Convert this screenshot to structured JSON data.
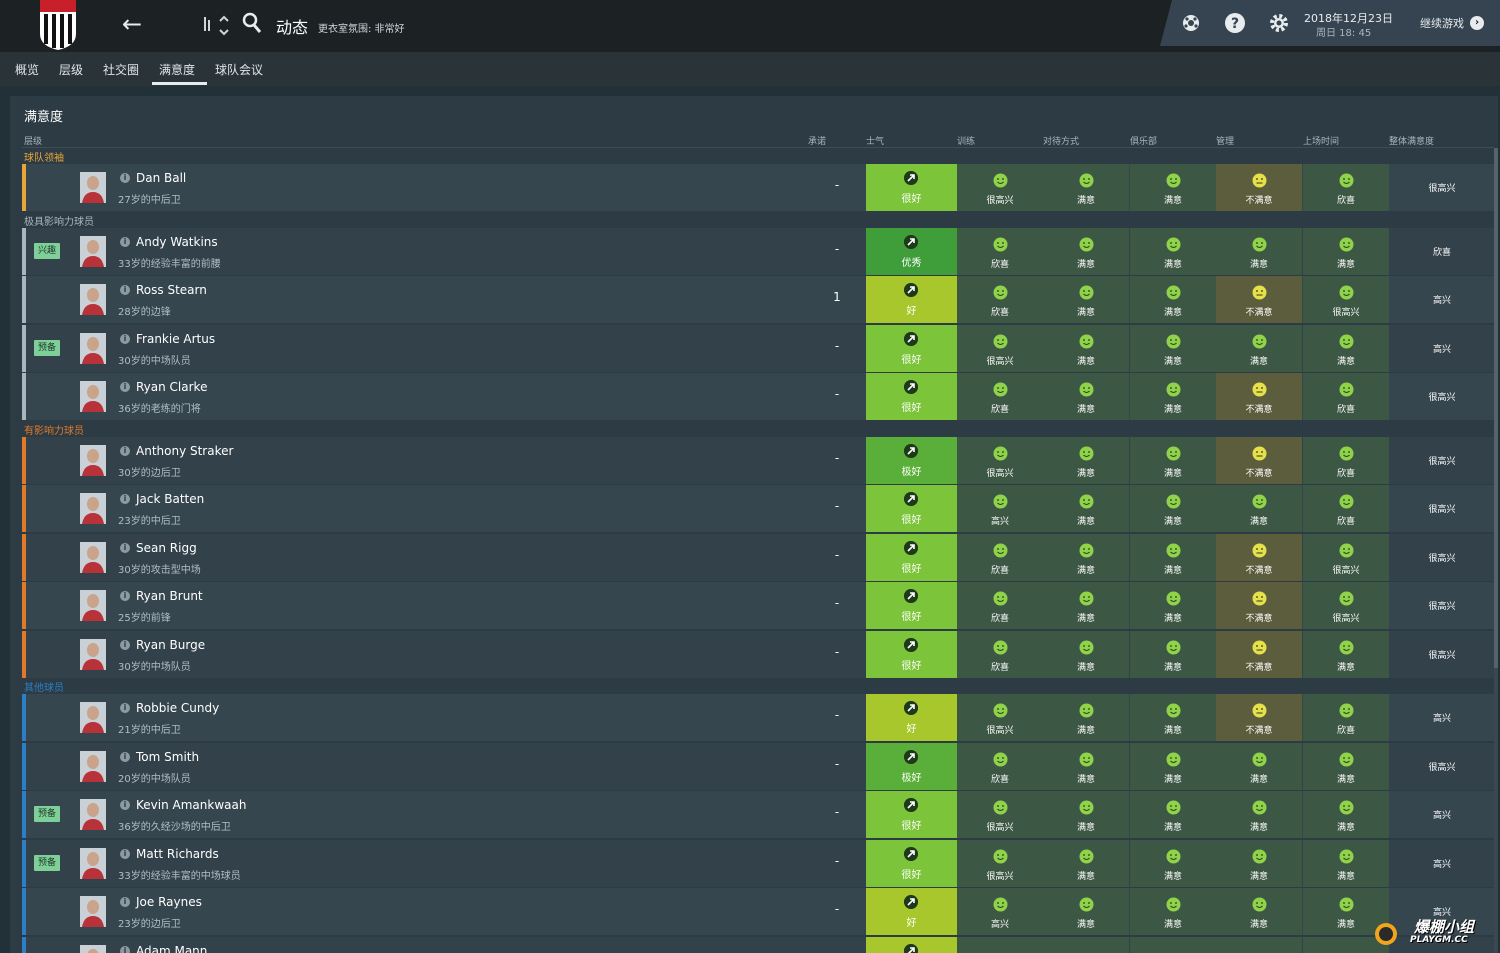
{
  "header": {
    "title": "动态",
    "atmosphere": "更衣室氛围: 非常好",
    "date": "2018年12月23日",
    "day_time": "周日 18: 45",
    "continue": "继续游戏"
  },
  "tabs": [
    "概览",
    "层级",
    "社交圈",
    "满意度",
    "球队会议"
  ],
  "active_tab": "满意度",
  "panel": {
    "title": "满意度",
    "columns": {
      "hierarchy": "层级",
      "promise": "承诺",
      "morale": "士气",
      "training": "训练",
      "treatment": "对待方式",
      "club": "俱乐部",
      "management": "管理",
      "playing_time": "上场时间",
      "overall": "整体满意度"
    }
  },
  "groups": [
    {
      "label": "球队领袖",
      "color": "#e8a53a",
      "players": [
        {
          "name": "Dan Ball",
          "desc": "27岁的中后卫",
          "badge": "",
          "promise": "-",
          "morale": "很好",
          "morale_color": "#7cc53a",
          "training": "很高兴",
          "treatment": "满意",
          "club": "满意",
          "management": "不满意",
          "playing_time": "欣喜",
          "overall": "很高兴",
          "red": false
        }
      ]
    },
    {
      "label": "极具影响力球员",
      "color": "#aab6bd",
      "players": [
        {
          "name": "Andy Watkins",
          "desc": "33岁的经验丰富的前腰",
          "badge": "兴趣",
          "promise": "-",
          "morale": "优秀",
          "morale_color": "#3f9e3a",
          "training": "欣喜",
          "treatment": "满意",
          "club": "满意",
          "management": "满意",
          "playing_time": "满意",
          "overall": "欣喜",
          "red": false
        },
        {
          "name": "Ross Stearn",
          "desc": "28岁的边锋",
          "badge": "",
          "promise": "1",
          "morale": "好",
          "morale_color": "#a8c72c",
          "training": "欣喜",
          "treatment": "满意",
          "club": "满意",
          "management": "不满意",
          "playing_time": "很高兴",
          "overall": "高兴",
          "red": false
        },
        {
          "name": "Frankie Artus",
          "desc": "30岁的中场队员",
          "badge": "预备",
          "promise": "-",
          "morale": "很好",
          "morale_color": "#7cc53a",
          "training": "很高兴",
          "treatment": "满意",
          "club": "满意",
          "management": "满意",
          "playing_time": "满意",
          "overall": "高兴",
          "red": true
        },
        {
          "name": "Ryan Clarke",
          "desc": "36岁的老练的门将",
          "badge": "",
          "promise": "-",
          "morale": "很好",
          "morale_color": "#7cc53a",
          "training": "欣喜",
          "treatment": "满意",
          "club": "满意",
          "management": "不满意",
          "playing_time": "欣喜",
          "overall": "很高兴",
          "red": false
        }
      ]
    },
    {
      "label": "有影响力球员",
      "color": "#e07a2a",
      "players": [
        {
          "name": "Anthony Straker",
          "desc": "30岁的边后卫",
          "badge": "",
          "promise": "-",
          "morale": "极好",
          "morale_color": "#5aaf3a",
          "training": "很高兴",
          "treatment": "满意",
          "club": "满意",
          "management": "不满意",
          "playing_time": "欣喜",
          "overall": "很高兴",
          "red": false
        },
        {
          "name": "Jack Batten",
          "desc": "23岁的中后卫",
          "badge": "",
          "promise": "-",
          "morale": "很好",
          "morale_color": "#7cc53a",
          "training": "高兴",
          "treatment": "满意",
          "club": "满意",
          "management": "满意",
          "playing_time": "欣喜",
          "overall": "很高兴",
          "red": false
        },
        {
          "name": "Sean Rigg",
          "desc": "30岁的攻击型中场",
          "badge": "",
          "promise": "-",
          "morale": "很好",
          "morale_color": "#7cc53a",
          "training": "欣喜",
          "treatment": "满意",
          "club": "满意",
          "management": "不满意",
          "playing_time": "很高兴",
          "overall": "很高兴",
          "red": false
        },
        {
          "name": "Ryan Brunt",
          "desc": "25岁的前锋",
          "badge": "",
          "promise": "-",
          "morale": "很好",
          "morale_color": "#7cc53a",
          "training": "欣喜",
          "treatment": "满意",
          "club": "满意",
          "management": "不满意",
          "playing_time": "很高兴",
          "overall": "很高兴",
          "red": false
        },
        {
          "name": "Ryan Burge",
          "desc": "30岁的中场队员",
          "badge": "",
          "promise": "-",
          "morale": "很好",
          "morale_color": "#7cc53a",
          "training": "欣喜",
          "treatment": "满意",
          "club": "满意",
          "management": "不满意",
          "playing_time": "满意",
          "overall": "很高兴",
          "red": false
        }
      ]
    },
    {
      "label": "其他球员",
      "color": "#2a7fc7",
      "players": [
        {
          "name": "Robbie Cundy",
          "desc": "21岁的中后卫",
          "badge": "",
          "promise": "-",
          "morale": "好",
          "morale_color": "#a8c72c",
          "training": "很高兴",
          "treatment": "满意",
          "club": "满意",
          "management": "不满意",
          "playing_time": "欣喜",
          "overall": "高兴",
          "red": false
        },
        {
          "name": "Tom Smith",
          "desc": "20岁的中场队员",
          "badge": "",
          "promise": "-",
          "morale": "极好",
          "morale_color": "#5aaf3a",
          "training": "欣喜",
          "treatment": "满意",
          "club": "满意",
          "management": "满意",
          "playing_time": "满意",
          "overall": "很高兴",
          "red": false
        },
        {
          "name": "Kevin Amankwaah",
          "desc": "36岁的久经沙场的中后卫",
          "badge": "预备",
          "promise": "-",
          "morale": "很好",
          "morale_color": "#7cc53a",
          "training": "很高兴",
          "treatment": "满意",
          "club": "满意",
          "management": "满意",
          "playing_time": "满意",
          "overall": "高兴",
          "red": true
        },
        {
          "name": "Matt Richards",
          "desc": "33岁的经验丰富的中场球员",
          "badge": "预备",
          "promise": "-",
          "morale": "很好",
          "morale_color": "#7cc53a",
          "training": "很高兴",
          "treatment": "满意",
          "club": "满意",
          "management": "满意",
          "playing_time": "满意",
          "overall": "高兴",
          "red": false
        },
        {
          "name": "Joe Raynes",
          "desc": "23岁的边后卫",
          "badge": "",
          "promise": "-",
          "morale": "好",
          "morale_color": "#a8c72c",
          "training": "高兴",
          "treatment": "满意",
          "club": "满意",
          "management": "满意",
          "playing_time": "满意",
          "overall": "高兴",
          "red": false
        },
        {
          "name": "Adam Mann",
          "desc": "",
          "badge": "",
          "promise": "",
          "morale": "",
          "morale_color": "#a8c72c",
          "training": "",
          "treatment": "",
          "club": "",
          "management": "",
          "playing_time": "",
          "overall": "",
          "red": false
        }
      ]
    }
  ],
  "watermark": {
    "line1": "爆棚小组",
    "line2": "PLAYGM.CC"
  },
  "icons": [
    "crest-icon",
    "back-arrow-icon",
    "sort-icon",
    "search-icon",
    "ball-icon",
    "help-icon",
    "settings-icon",
    "continue-arrow-icon",
    "info-icon",
    "smile-face-icon",
    "neutral-face-icon",
    "morale-arrow-icon",
    "alert-icon"
  ]
}
